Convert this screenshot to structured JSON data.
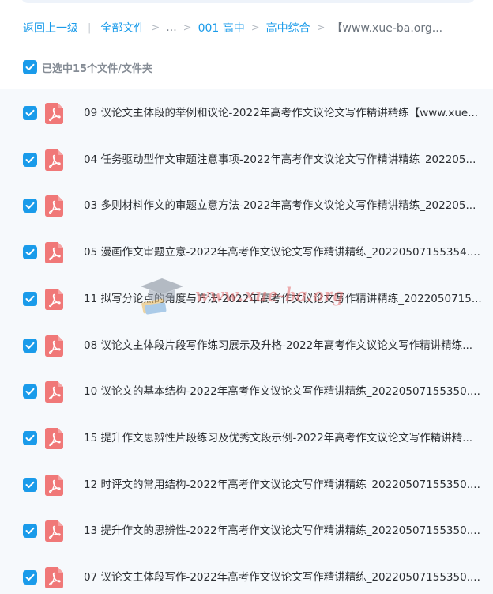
{
  "breadcrumb": {
    "back": "返回上一级",
    "all_files": "全部文件",
    "ellipsis": "...",
    "level1": "001 高中",
    "level2": "高中综合",
    "current": "【www.xue-ba.org..."
  },
  "selection": {
    "label": "已选中15个文件/文件夹"
  },
  "files": [
    {
      "name": "09 议论文主体段的举例和议论-2022年高考作文议论文写作精讲精练【www.xue..."
    },
    {
      "name": "04 任务驱动型作文审题注意事项-2022年高考作文议论文写作精讲精练_202205..."
    },
    {
      "name": "03 多则材料作文的审题立意方法-2022年高考作文议论文写作精讲精练_202205..."
    },
    {
      "name": "05 漫画作文审题立意-2022年高考作文议论文写作精讲精练_20220507155354...."
    },
    {
      "name": "11 拟写分论点的角度与方法-2022年高考作文议论文写作精讲精练_2022050715..."
    },
    {
      "name": "08 议论文主体段片段写作练习展示及升格-2022年高考作文议论文写作精讲精练..."
    },
    {
      "name": "10 议论文的基本结构-2022年高考作文议论文写作精讲精练_20220507155350...."
    },
    {
      "name": "15 提升作文思辨性片段练习及优秀文段示例-2022年高考作文议论文写作精讲精..."
    },
    {
      "name": "12 时评文的常用结构-2022年高考作文议论文写作精讲精练_20220507155350...."
    },
    {
      "name": "13 提升作文的思辨性-2022年高考作文议论文写作精讲精练_20220507155350...."
    },
    {
      "name": "07 议论文主体段写作-2022年高考作文议论文写作精讲精练_20220507155350...."
    }
  ],
  "watermark": {
    "text": "www.xue-ba.org"
  },
  "colors": {
    "accent": "#1a9bea",
    "pdf_icon": "#f07878",
    "list_bg": "#f6f9fc"
  }
}
